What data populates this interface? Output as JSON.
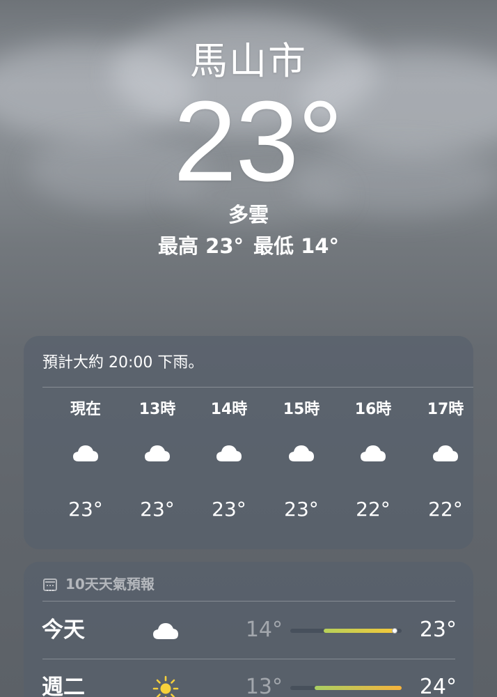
{
  "location": {
    "city": "馬山市"
  },
  "current": {
    "temperature": "23",
    "degree": "°",
    "condition": "多雲",
    "high_label": "最高",
    "high": "23°",
    "low_label": "最低",
    "low": "14°"
  },
  "hourly": {
    "summary": "預計大約 20:00 下雨。",
    "items": [
      {
        "label": "現在",
        "icon": "cloud-icon",
        "temp": "23°"
      },
      {
        "label": "13時",
        "icon": "cloud-icon",
        "temp": "23°"
      },
      {
        "label": "14時",
        "icon": "cloud-icon",
        "temp": "23°"
      },
      {
        "label": "15時",
        "icon": "cloud-icon",
        "temp": "23°"
      },
      {
        "label": "16時",
        "icon": "cloud-icon",
        "temp": "22°"
      },
      {
        "label": "17時",
        "icon": "cloud-icon",
        "temp": "22°"
      }
    ]
  },
  "daily": {
    "title": "10天天氣預報",
    "title_icon": "calendar-icon",
    "days": [
      {
        "name": "今天",
        "icon": "cloud-icon",
        "low": "14°",
        "high": "23°",
        "bar_start": 0.3,
        "bar_end": 0.94,
        "current_marker": 0.94,
        "bar_colors": [
          "#b7d15a",
          "#f3c83a"
        ]
      },
      {
        "name": "週二",
        "icon": "sun-icon",
        "low": "13°",
        "high": "24°",
        "bar_start": 0.22,
        "bar_end": 1.0,
        "bar_colors": [
          "#a9cf63",
          "#f6b33c"
        ]
      }
    ]
  },
  "colors": {
    "card_bg": "#56606c",
    "sun": "#f7d13b",
    "text": "#ffffff"
  }
}
